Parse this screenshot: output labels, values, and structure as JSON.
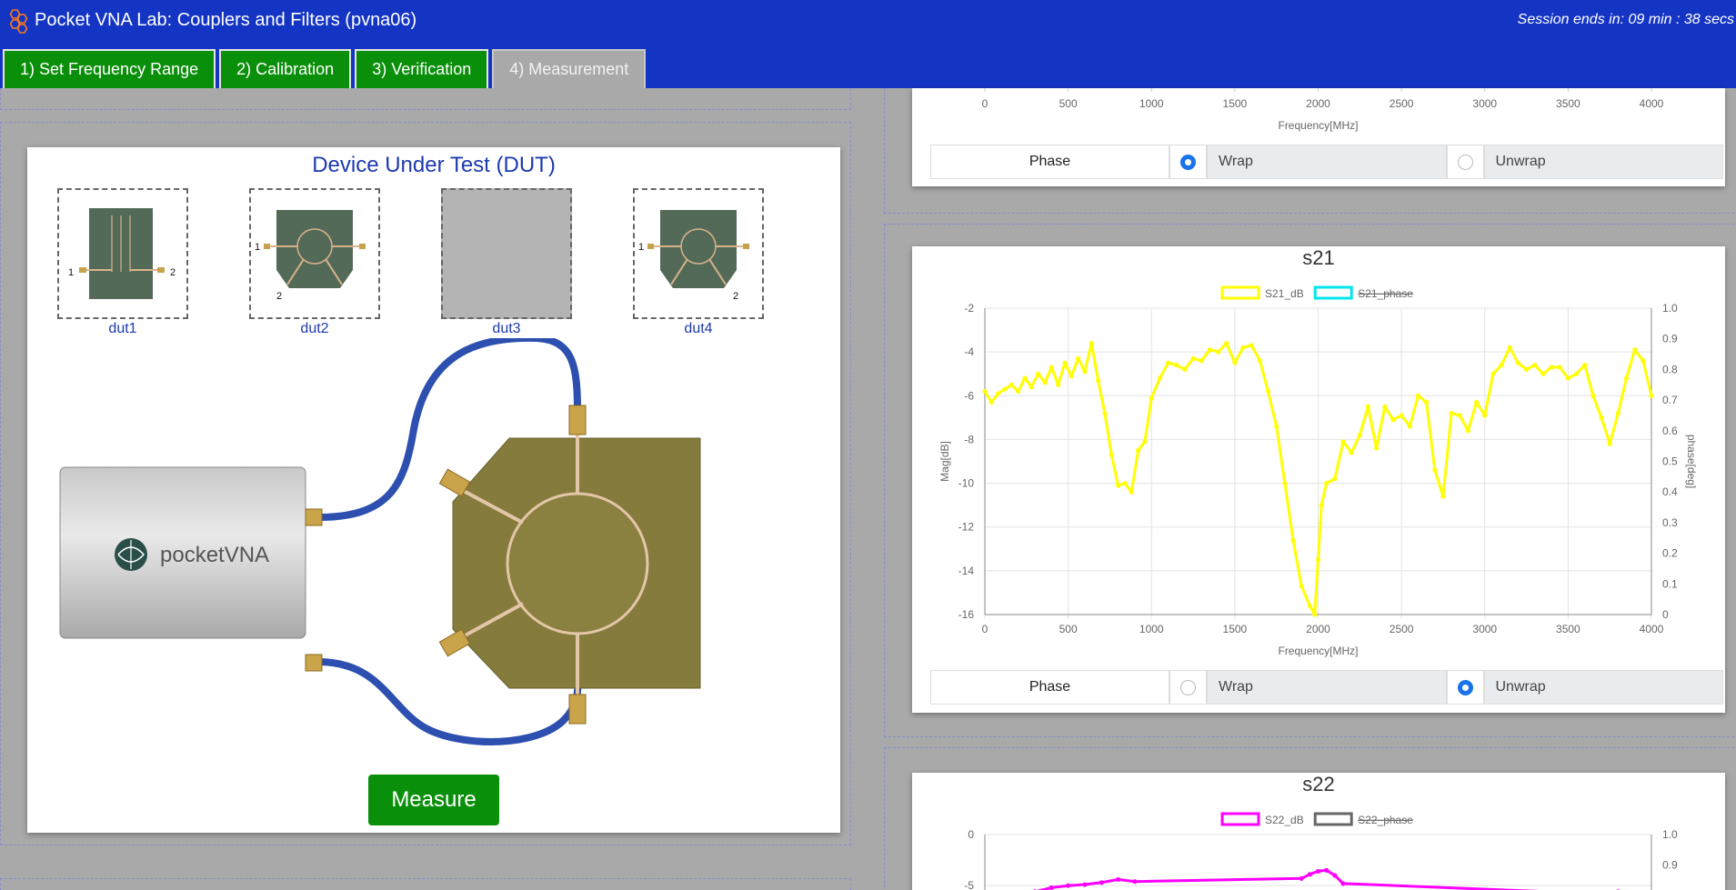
{
  "app": {
    "title": "Pocket VNA Lab: Couplers and Filters (pvna06)",
    "session": "Session ends in: 09 min : 38 secs"
  },
  "tabs": [
    {
      "label": "1) Set Frequency Range",
      "active": false
    },
    {
      "label": "2) Calibration",
      "active": false
    },
    {
      "label": "3) Verification",
      "active": false
    },
    {
      "label": "4) Measurement",
      "active": true
    }
  ],
  "dut_panel": {
    "title": "Device Under Test (DUT)",
    "duts": [
      {
        "label": "dut1",
        "port_labels": [
          "1",
          "2"
        ]
      },
      {
        "label": "dut2",
        "port_labels": [
          "1",
          "2"
        ]
      },
      {
        "label": "dut3",
        "port_labels": []
      },
      {
        "label": "dut4",
        "port_labels": [
          "1",
          "2"
        ]
      }
    ],
    "device_brand": "pocketVNA",
    "measure_label": "Measure"
  },
  "phase_controls": [
    {
      "label": "Phase",
      "wrap_label": "Wrap",
      "unwrap_label": "Unwrap",
      "selected": "wrap"
    },
    {
      "label": "Phase",
      "wrap_label": "Wrap",
      "unwrap_label": "Unwrap",
      "selected": "unwrap"
    }
  ],
  "colors": {
    "header": "#1434c4",
    "tab_green": "#0a8f0a",
    "link_blue": "#1d3ab0",
    "s21_trace": "#ffff00",
    "s21_phase": "#00e5ee",
    "s22_trace": "#ff00ff",
    "s22_phase": "#666666"
  },
  "chart_data": [
    {
      "id": "top_partial",
      "type": "line",
      "title": "",
      "xlabel": "Frequency[MHz]",
      "x_ticks": [
        0,
        500,
        1000,
        1500,
        2000,
        2500,
        3000,
        3500,
        4000
      ],
      "xlim": [
        0,
        4000
      ],
      "series": []
    },
    {
      "id": "s21",
      "type": "line",
      "title": "s21",
      "xlabel": "Frequency[MHz]",
      "ylabel": "Mag[dB]",
      "y2label": "phase[deg]",
      "xlim": [
        0,
        4000
      ],
      "ylim": [
        -16,
        -2
      ],
      "y2lim": [
        0,
        1.0
      ],
      "x_ticks": [
        0,
        500,
        1000,
        1500,
        2000,
        2500,
        3000,
        3500,
        4000
      ],
      "y_ticks": [
        -2,
        -4,
        -6,
        -8,
        -10,
        -12,
        -14,
        -16
      ],
      "y2_ticks": [
        "1.0",
        "0.9",
        "0.8",
        "0.7",
        "0.6",
        "0.5",
        "0.4",
        "0.3",
        "0.2",
        "0.1",
        "0"
      ],
      "grid": true,
      "legend_position": "top-center",
      "series": [
        {
          "name": "S21_dB",
          "hidden": false,
          "x": [
            0,
            40,
            80,
            120,
            160,
            200,
            240,
            280,
            320,
            360,
            400,
            440,
            480,
            520,
            560,
            600,
            640,
            680,
            720,
            760,
            800,
            840,
            880,
            920,
            960,
            1000,
            1050,
            1100,
            1150,
            1200,
            1250,
            1300,
            1350,
            1400,
            1450,
            1500,
            1550,
            1600,
            1650,
            1700,
            1750,
            1800,
            1850,
            1900,
            1950,
            1980,
            2000,
            2020,
            2050,
            2100,
            2150,
            2200,
            2250,
            2300,
            2350,
            2400,
            2450,
            2500,
            2550,
            2600,
            2650,
            2700,
            2750,
            2800,
            2850,
            2900,
            2950,
            3000,
            3050,
            3100,
            3150,
            3200,
            3250,
            3300,
            3350,
            3400,
            3450,
            3500,
            3550,
            3600,
            3650,
            3700,
            3750,
            3800,
            3850,
            3900,
            3950,
            4000
          ],
          "y": [
            -5.8,
            -6.3,
            -5.9,
            -5.7,
            -5.5,
            -5.8,
            -5.2,
            -5.6,
            -5.0,
            -5.4,
            -4.7,
            -5.5,
            -4.5,
            -5.1,
            -4.3,
            -4.9,
            -3.6,
            -5.3,
            -6.8,
            -8.7,
            -10.1,
            -10.0,
            -10.4,
            -8.5,
            -8.1,
            -6.1,
            -5.2,
            -4.5,
            -4.6,
            -4.8,
            -4.3,
            -4.4,
            -3.9,
            -4.0,
            -3.6,
            -4.5,
            -3.8,
            -3.7,
            -4.4,
            -5.8,
            -7.4,
            -10.0,
            -12.6,
            -14.7,
            -15.6,
            -16.0,
            -13.5,
            -11.0,
            -10.0,
            -9.8,
            -8.1,
            -8.6,
            -7.8,
            -6.5,
            -8.4,
            -6.5,
            -7.1,
            -6.9,
            -7.4,
            -6.0,
            -6.3,
            -9.4,
            -10.6,
            -6.8,
            -6.9,
            -7.6,
            -6.3,
            -6.9,
            -5.0,
            -4.6,
            -3.8,
            -4.5,
            -4.8,
            -4.6,
            -5.0,
            -4.7,
            -4.7,
            -5.2,
            -5.0,
            -4.6,
            -6.0,
            -7.0,
            -8.2,
            -6.8,
            -5.2,
            -3.9,
            -4.4,
            -6.0
          ]
        },
        {
          "name": "S21_phase",
          "hidden": true,
          "x": [],
          "y": []
        }
      ]
    },
    {
      "id": "s22",
      "type": "line",
      "title": "s22",
      "xlim": [
        0,
        4000
      ],
      "ylim": [
        -30,
        0
      ],
      "y_ticks": [
        0,
        -5
      ],
      "y2_ticks": [
        "1.0",
        "0.9"
      ],
      "legend_position": "top-center",
      "series": [
        {
          "name": "S22_dB",
          "hidden": false,
          "x": [
            300,
            400,
            500,
            600,
            700,
            800,
            900,
            1900,
            1950,
            2000,
            2050,
            2100,
            2150,
            3700,
            3800
          ],
          "y": [
            -5.6,
            -5.2,
            -5.0,
            -4.9,
            -4.7,
            -4.4,
            -4.6,
            -4.3,
            -3.9,
            -3.6,
            -3.5,
            -4.0,
            -4.8,
            -5.8,
            -5.6
          ]
        },
        {
          "name": "S22_phase",
          "hidden": true,
          "x": [],
          "y": []
        }
      ]
    }
  ]
}
